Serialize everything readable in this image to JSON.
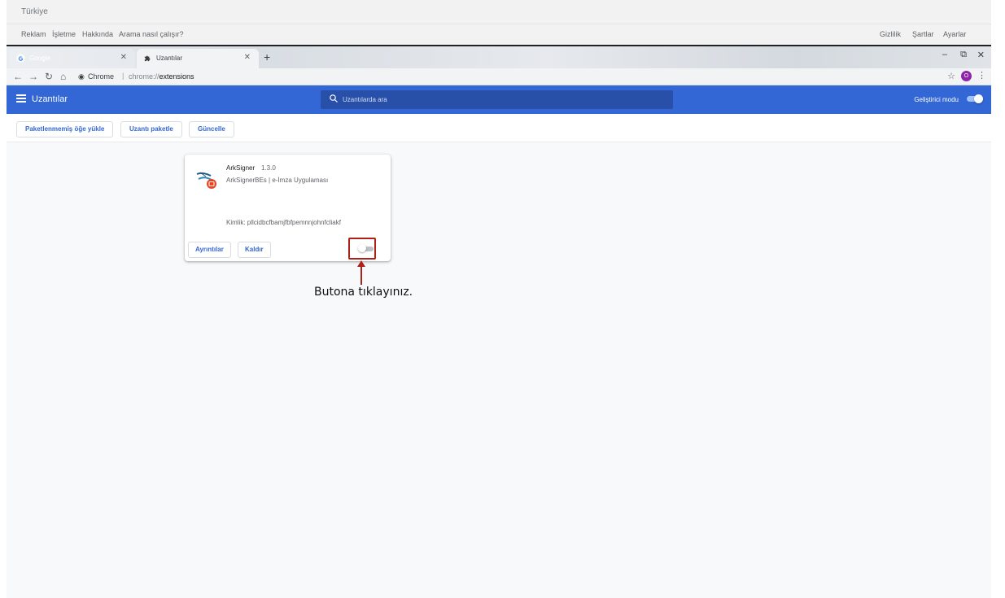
{
  "google_footer": {
    "country": "Türkiye",
    "left_links": [
      "Reklam",
      "İşletme",
      "Hakkında",
      "Arama nasıl çalışır?"
    ],
    "right_links": [
      "Gizlilik",
      "Şartlar",
      "Ayarlar"
    ]
  },
  "tabs": [
    {
      "title": "Google",
      "icon": "google-g-icon",
      "active": false
    },
    {
      "title": "Uzantılar",
      "icon": "puzzle-icon",
      "active": true
    }
  ],
  "window_controls": [
    "–",
    "⧉",
    "✕"
  ],
  "omnibox": {
    "host": "Chrome",
    "scheme": "chrome://",
    "path": "extensions"
  },
  "profile_initial": "O",
  "header": {
    "title": "Uzantılar",
    "search_placeholder": "Uzantılarda ara",
    "developer_mode_label": "Geliştirici modu",
    "developer_mode_on": true,
    "accent": "#3367d6"
  },
  "toolbar": {
    "load_unpacked": "Paketlenmemiş öğe yükle",
    "pack_extension": "Uzantı paketle",
    "update": "Güncelle"
  },
  "extension": {
    "name": "ArkSigner",
    "version": "1.3.0",
    "description": "ArkSignerBEs | e-İmza Uygulaması",
    "id_text": "Kimlik: pllcidbcfbamjfbfpemnnjohnfcliakf",
    "details_label": "Ayrıntılar",
    "remove_label": "Kaldır",
    "enabled": false
  },
  "annotation": {
    "text": "Butona tıklayınız.",
    "color": "#b0201a"
  }
}
